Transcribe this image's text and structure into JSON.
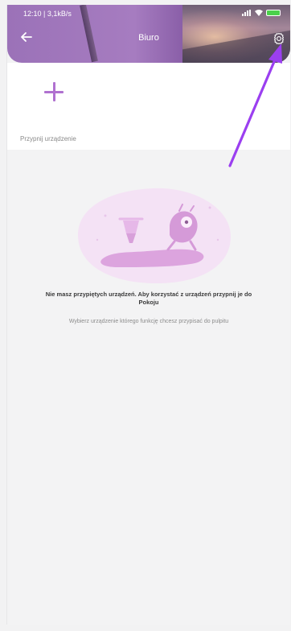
{
  "status_bar": {
    "time": "12:10 | 3,1kB/s"
  },
  "header": {
    "title": "Biuro"
  },
  "add_section": {
    "label": "Przypnij urządzenie"
  },
  "empty_state": {
    "title_line1": "Nie masz przypiętych urządzeń. Aby korzystać z urządzeń przypnij je do",
    "title_line2": "Pokoju",
    "subtitle": "Wybierz urządzenie którego funkcję chcesz przypisać do pulpitu"
  },
  "colors": {
    "accent": "#b071d0",
    "header": "#a67cc0",
    "annotation_arrow": "#9b3ff0"
  },
  "icons": [
    "back-arrow-icon",
    "settings-gear-icon",
    "plus-icon",
    "battery-icon",
    "signal-icon",
    "wifi-icon"
  ]
}
